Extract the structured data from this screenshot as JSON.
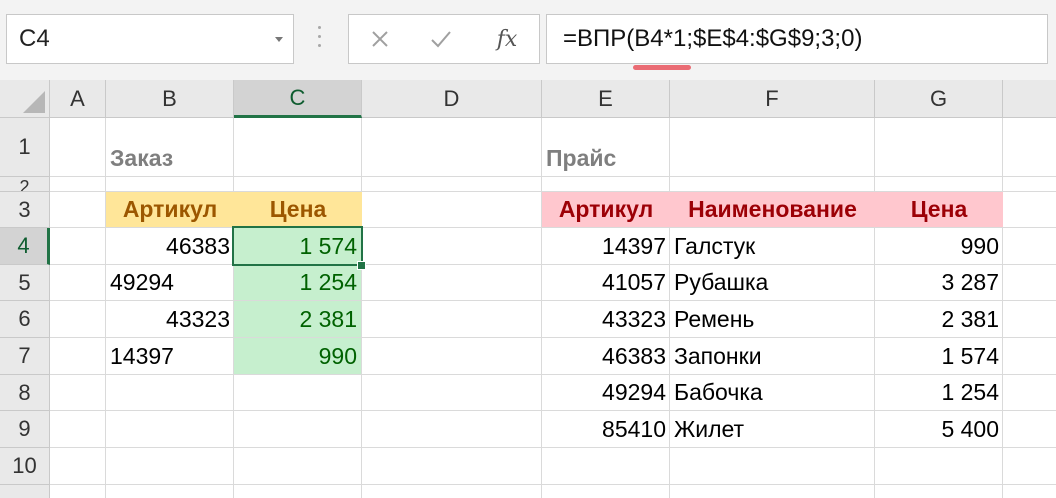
{
  "name_box": {
    "value": "C4"
  },
  "formula_bar": {
    "cancel_icon": "cross-icon",
    "enter_icon": "checkmark-icon",
    "function_icon_text": "fx",
    "formula": "=ВПР(B4*1;$E$4:$G$9;3;0)"
  },
  "columns": [
    "A",
    "B",
    "C",
    "D",
    "E",
    "F",
    "G"
  ],
  "rows": [
    "1",
    "2",
    "3",
    "4",
    "5",
    "6",
    "7",
    "8",
    "9",
    "10"
  ],
  "active_cell": {
    "column": "C",
    "row": "4"
  },
  "colors": {
    "selection_green": "#217346",
    "header_fill_yellow": "#ffe699",
    "header_text_yellow": "#9c5700",
    "header_fill_pink": "#ffc7ce",
    "header_text_pink": "#9c0006",
    "result_fill_green": "#c6efce",
    "result_text_green": "#006100",
    "formula_highlight": "#ea6c74"
  },
  "order_table": {
    "title": "Заказ",
    "headers": {
      "article": "Артикул",
      "price": "Цена"
    },
    "rows": [
      {
        "article": "46383",
        "price": "1 574"
      },
      {
        "article": "49294",
        "price": "1 254"
      },
      {
        "article": "43323",
        "price": "2 381"
      },
      {
        "article": "14397",
        "price": "990"
      }
    ]
  },
  "price_table": {
    "title": "Прайс",
    "headers": {
      "article": "Артикул",
      "name": "Наименование",
      "price": "Цена"
    },
    "rows": [
      {
        "article": "14397",
        "name": "Галстук",
        "price": "990"
      },
      {
        "article": "41057",
        "name": "Рубашка",
        "price": "3 287"
      },
      {
        "article": "43323",
        "name": "Ремень",
        "price": "2 381"
      },
      {
        "article": "46383",
        "name": "Запонки",
        "price": "1 574"
      },
      {
        "article": "49294",
        "name": "Бабочка",
        "price": "1 254"
      },
      {
        "article": "85410",
        "name": "Жилет",
        "price": "5 400"
      }
    ]
  }
}
